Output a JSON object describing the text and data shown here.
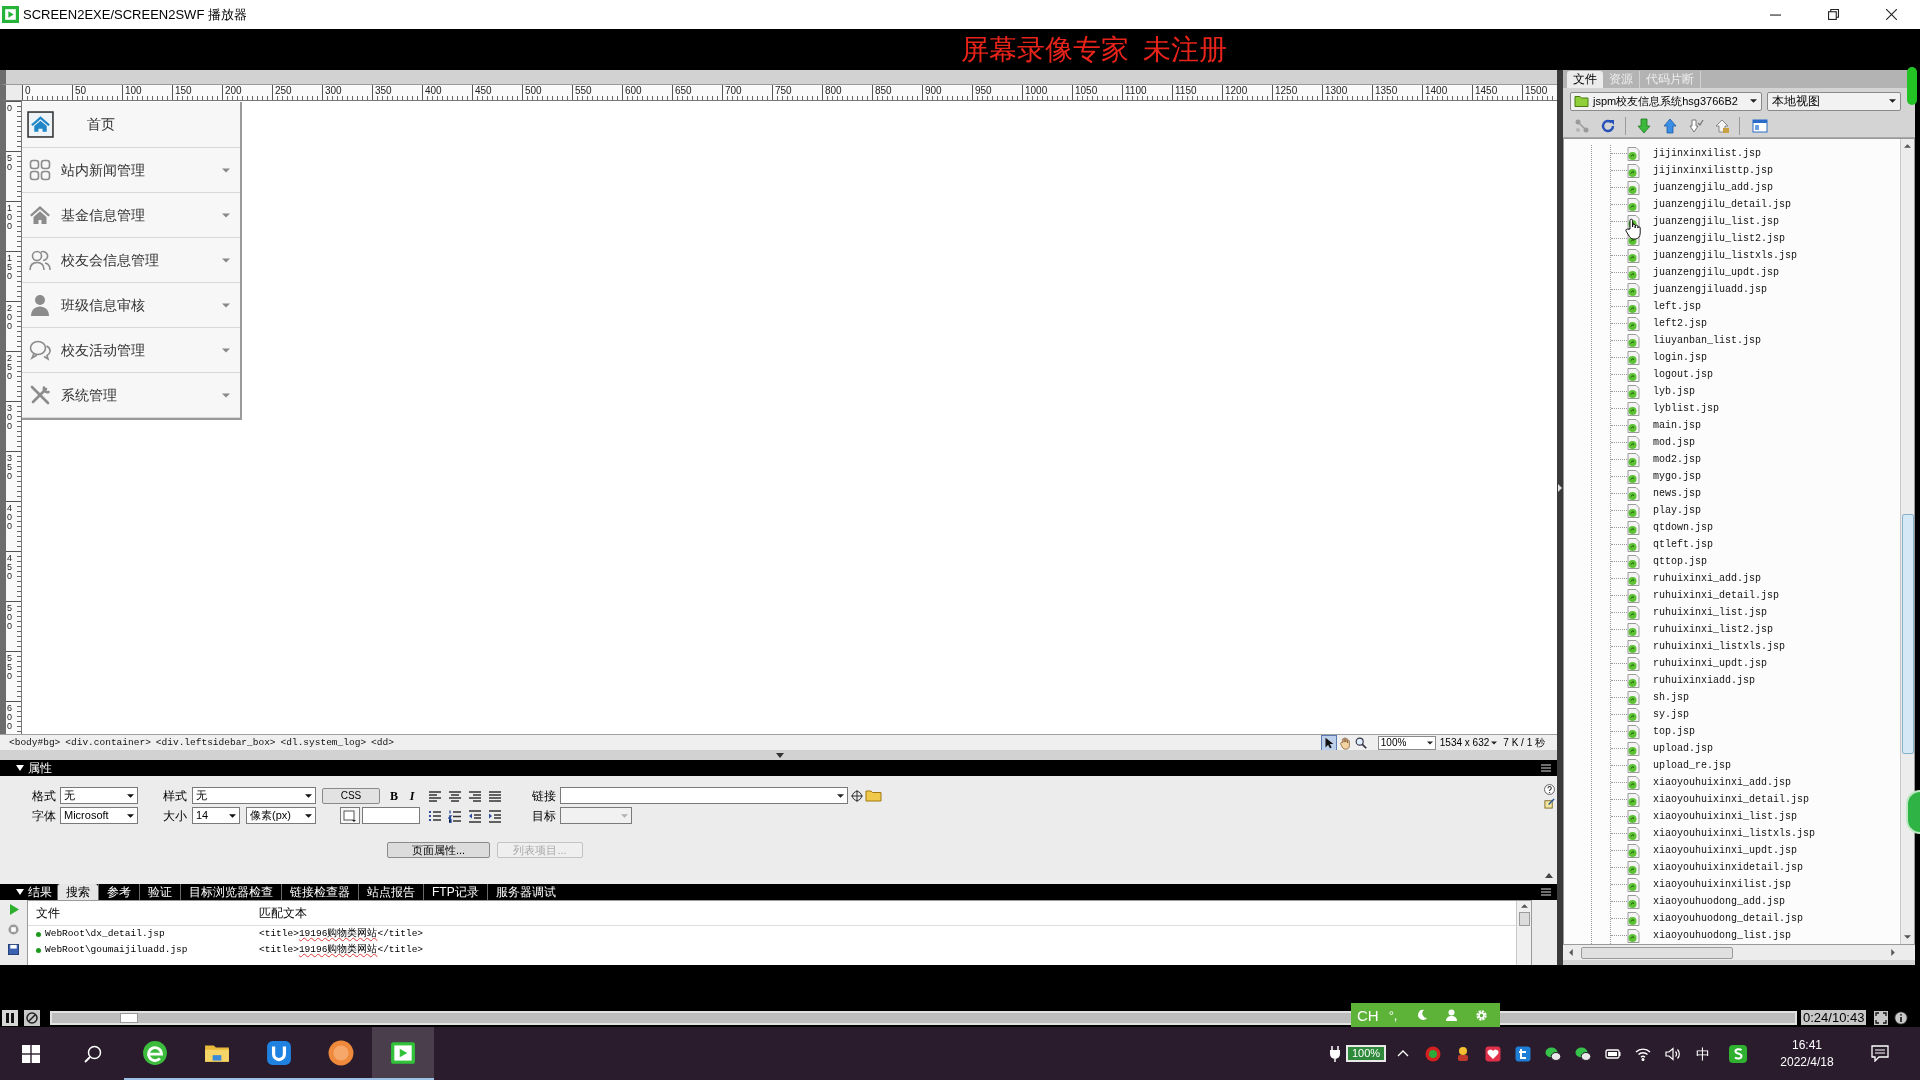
{
  "window": {
    "title": "SCREEN2EXE/SCREEN2SWF 播放器"
  },
  "banner": {
    "text": "屏幕录像专家  未注册"
  },
  "document": {
    "ruler": {
      "horizontal": [
        "0",
        "50",
        "100",
        "150",
        "200",
        "250",
        "300",
        "350",
        "400",
        "450",
        "500",
        "550",
        "600",
        "650",
        "700",
        "750",
        "800",
        "850",
        "900",
        "950",
        "1000",
        "1050",
        "1100",
        "1150",
        "1200",
        "1250",
        "1300",
        "1350",
        "1400",
        "1450",
        "1500"
      ],
      "vertical": [
        "0",
        "50",
        "100",
        "150",
        "200",
        "250",
        "300",
        "350",
        "400",
        "450",
        "500",
        "550",
        "600"
      ]
    },
    "menu": {
      "home": "首页",
      "items": [
        "站内新闻管理",
        "基金信息管理",
        "校友会信息管理",
        "班级信息审核",
        "校友活动管理",
        "系统管理"
      ]
    },
    "tag_selector": {
      "tags": [
        "<body#bg>",
        "<div.container>",
        "<div.leftsidebar_box>",
        "<dl.system_log>",
        "<dd>"
      ],
      "tools": [
        {
          "selected": true
        },
        {
          "selected": false
        },
        {
          "selected": false
        }
      ],
      "zoom": "100%",
      "window_size": "1534 x 632",
      "download_time": "7 K / 1 秒"
    }
  },
  "properties": {
    "title": "属性",
    "expanded": true,
    "format": {
      "label": "格式",
      "value": "无"
    },
    "class": {
      "label": "样式",
      "value": "无"
    },
    "css_button": "CSS",
    "bold": "B",
    "italic": "I",
    "link": {
      "label": "链接"
    },
    "font": {
      "label": "字体",
      "value": "Microsoft"
    },
    "size": {
      "label": "大小",
      "value": "14",
      "unit": "像素(px)"
    },
    "target": {
      "label": "目标",
      "disabled": true
    },
    "buttons": [
      {
        "label": "页面属性...",
        "disabled": false
      },
      {
        "label": "列表项目...",
        "disabled": true
      }
    ]
  },
  "results": {
    "title": "结果",
    "expanded": true,
    "tabs": [
      {
        "label": "搜索",
        "selected": true
      },
      {
        "label": "参考",
        "selected": false
      },
      {
        "label": "验证",
        "selected": false
      },
      {
        "label": "目标浏览器检查",
        "selected": false
      },
      {
        "label": "链接检查器",
        "selected": false
      },
      {
        "label": "站点报告",
        "selected": false
      },
      {
        "label": "FTP记录",
        "selected": false
      },
      {
        "label": "服务器调试",
        "selected": false
      }
    ],
    "columns": [
      "文件",
      "匹配文本"
    ],
    "rows": [
      {
        "file": "WebRoot\\dx_detail.jsp",
        "before": "<title>",
        "match": "19196购物类网站",
        "after": "</title>"
      },
      {
        "file": "WebRoot\\goumaijiluadd.jsp",
        "before": "<title>",
        "match": "19196购物类网站",
        "after": "</title>"
      }
    ]
  },
  "files_panel": {
    "tabs": [
      {
        "label": "文件",
        "selected": true
      },
      {
        "label": "资源",
        "selected": false
      },
      {
        "label": "代码片断",
        "selected": false
      }
    ],
    "site": "jspm校友信息系统hsg3766B2",
    "view": "本地视图",
    "files": [
      "jijinxinxilist.jsp",
      "jijinxinxilisttp.jsp",
      "juanzengjilu_add.jsp",
      "juanzengjilu_detail.jsp",
      "juanzengjilu_list.jsp",
      "juanzengjilu_list2.jsp",
      "juanzengjilu_listxls.jsp",
      "juanzengjilu_updt.jsp",
      "juanzengjiluadd.jsp",
      "left.jsp",
      "left2.jsp",
      "liuyanban_list.jsp",
      "login.jsp",
      "logout.jsp",
      "lyb.jsp",
      "lyblist.jsp",
      "main.jsp",
      "mod.jsp",
      "mod2.jsp",
      "mygo.jsp",
      "news.jsp",
      "play.jsp",
      "qtdown.jsp",
      "qtleft.jsp",
      "qttop.jsp",
      "ruhuixinxi_add.jsp",
      "ruhuixinxi_detail.jsp",
      "ruhuixinxi_list.jsp",
      "ruhuixinxi_list2.jsp",
      "ruhuixinxi_listxls.jsp",
      "ruhuixinxi_updt.jsp",
      "ruhuixinxiadd.jsp",
      "sh.jsp",
      "sy.jsp",
      "top.jsp",
      "upload.jsp",
      "upload_re.jsp",
      "xiaoyouhuixinxi_add.jsp",
      "xiaoyouhuixinxi_detail.jsp",
      "xiaoyouhuixinxi_list.jsp",
      "xiaoyouhuixinxi_listxls.jsp",
      "xiaoyouhuixinxi_updt.jsp",
      "xiaoyouhuixinxidetail.jsp",
      "xiaoyouhuixinxilist.jsp",
      "xiaoyouhuodong_add.jsp",
      "xiaoyouhuodong_detail.jsp",
      "xiaoyouhuodong_list.jsp"
    ]
  },
  "player": {
    "level": 0.044,
    "time": "0:24/10:43"
  },
  "ime_bar": {
    "language": "CH",
    "punctuation": "°,"
  },
  "taskbar": {
    "apps": [
      {
        "selected": false,
        "running": true
      },
      {
        "selected": false,
        "running": true
      },
      {
        "selected": false,
        "running": true
      },
      {
        "selected": false,
        "running": true
      },
      {
        "selected": true,
        "running": true
      }
    ],
    "battery": "100%",
    "input_method": "中",
    "time": "16:41",
    "date": "2022/4/18"
  }
}
